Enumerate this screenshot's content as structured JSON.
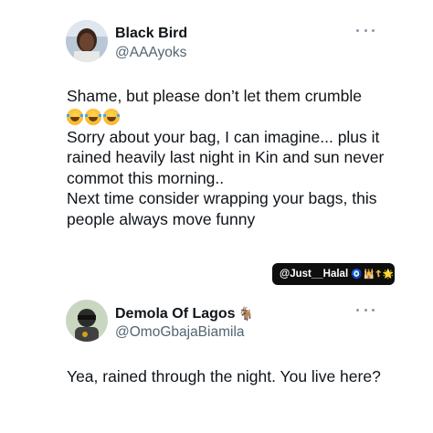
{
  "tweets": [
    {
      "name": "Black Bird",
      "handle": "@AAAyoks",
      "lines": [
        "Shame, but please don’t let them crumble",
        "Sorry about your bag, I can imagine... plus it rained heavily last night in Kin and sun never commot this morning..",
        "Next time consider wrapping your bags, this people always move funny"
      ],
      "emoji_icons": [
        "face-with-tears-of-joy-icon",
        "face-with-tears-of-joy-icon",
        "face-with-tears-of-joy-icon"
      ]
    },
    {
      "name": "Demola Of Lagos",
      "name_suffix": "🐐",
      "handle": "@OmoGbajaBiamila",
      "lines": [
        "Yea, rained through the night. You live here?"
      ]
    }
  ],
  "watermark": {
    "label": "@Just__Halal",
    "emojis": "🧿🕌☦🌟"
  },
  "colors": {
    "text": "#0f1419",
    "secondary": "#536471",
    "watermark_bg": "#0e0e0e"
  }
}
